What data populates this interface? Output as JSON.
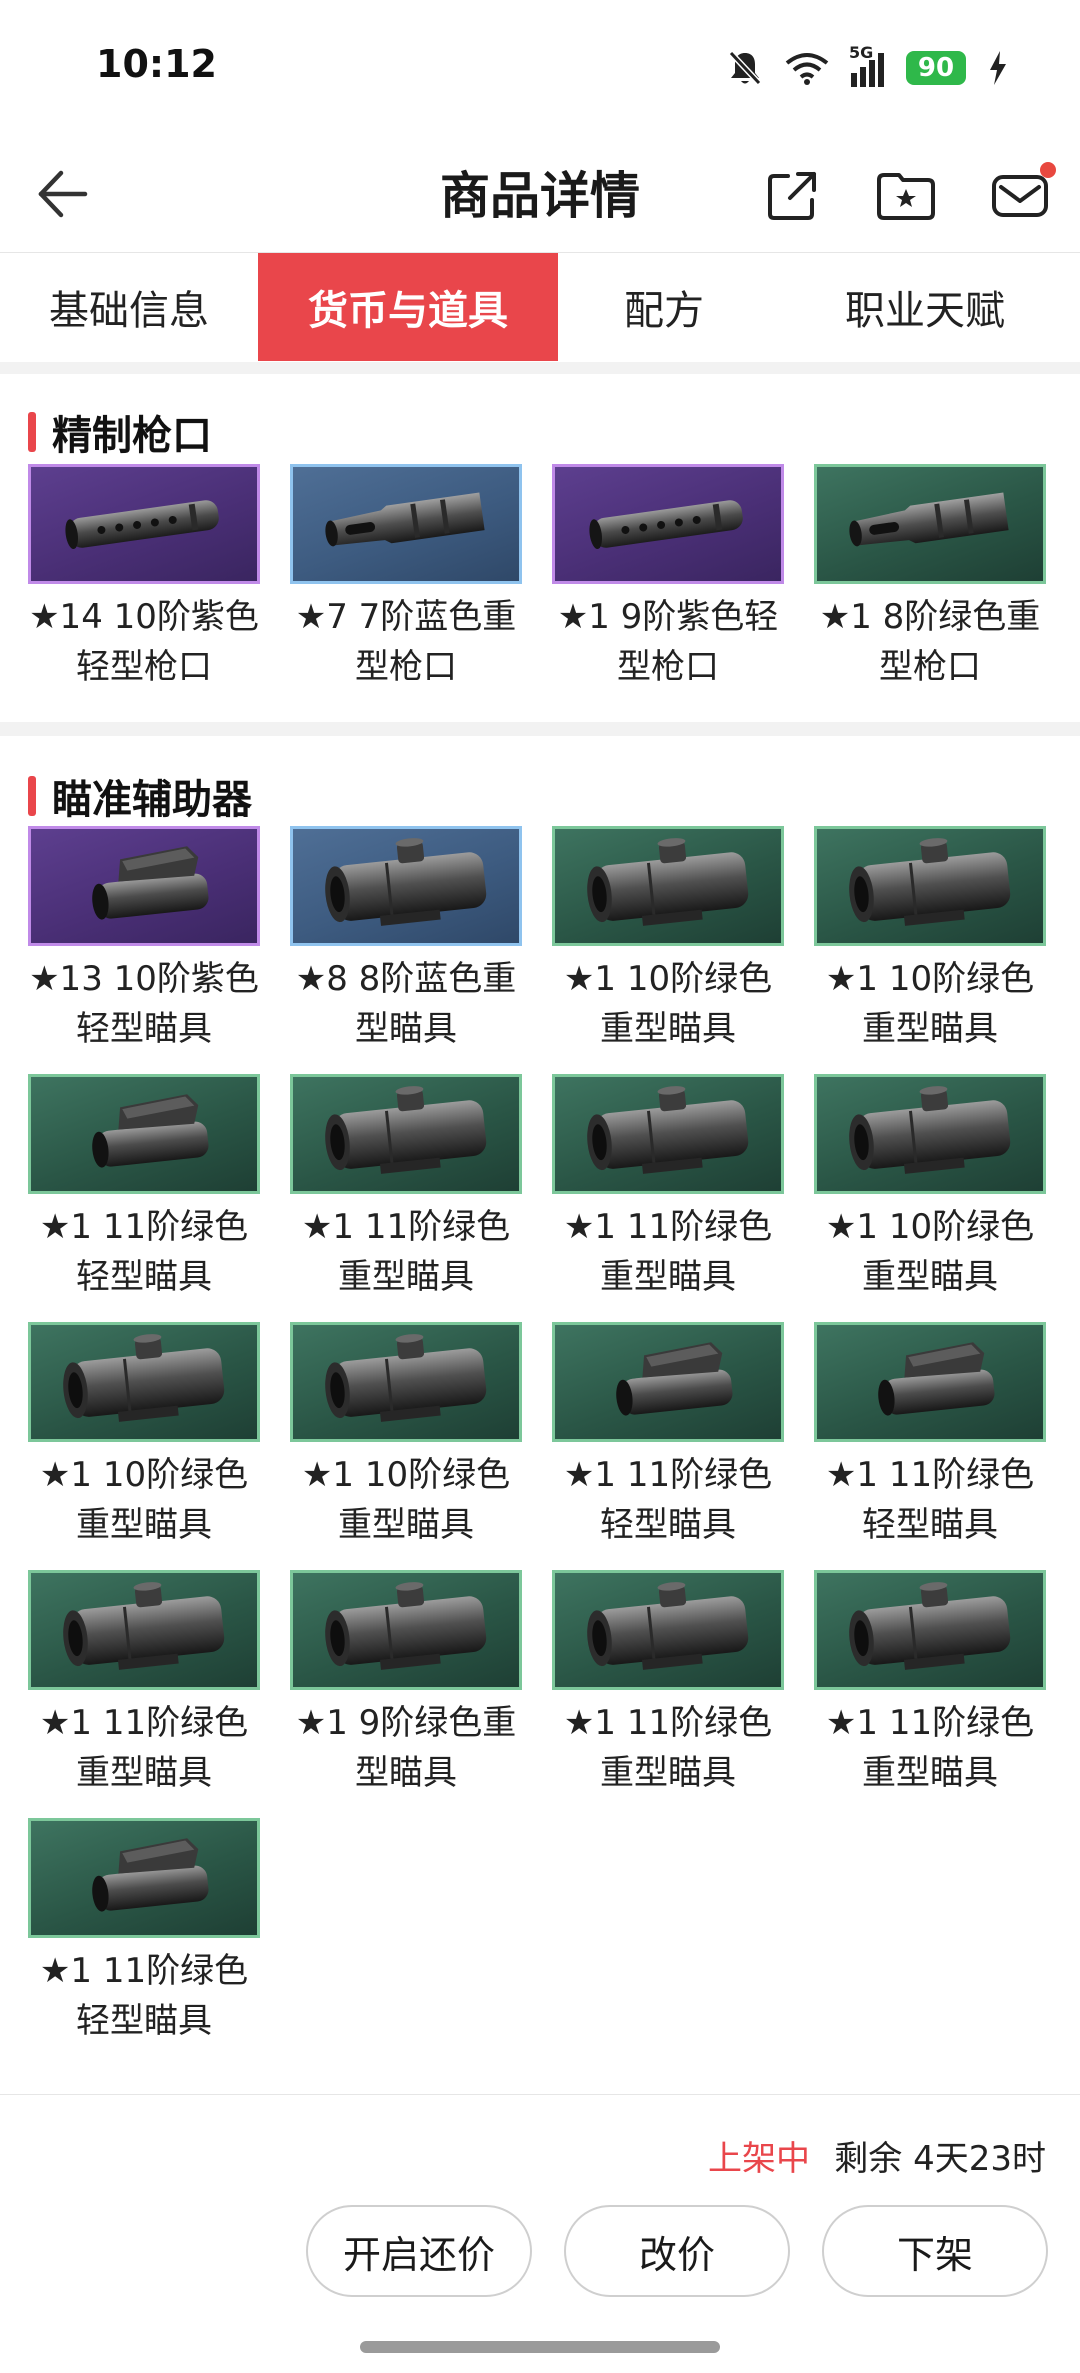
{
  "status_bar": {
    "time": "10:12",
    "network": "5G",
    "battery": "90",
    "icons": [
      "bell-muted-icon",
      "wifi-icon",
      "signal-icon",
      "battery-icon",
      "charging-icon"
    ]
  },
  "header": {
    "title": "商品详情",
    "icons": [
      "back-arrow-icon",
      "share-icon",
      "folder-star-icon",
      "mail-icon"
    ]
  },
  "tabs": [
    {
      "label": "基础信息",
      "active": false
    },
    {
      "label": "货币与道具",
      "active": true
    },
    {
      "label": "配方",
      "active": false
    },
    {
      "label": "职业天赋",
      "active": false
    }
  ],
  "sections": [
    {
      "title": "精制枪口",
      "items": [
        {
          "label": "★14 10阶紫色轻型枪口",
          "rarity": "purple",
          "icon": "muzzle-light-icon"
        },
        {
          "label": "★7 7阶蓝色重型枪口",
          "rarity": "blue",
          "icon": "muzzle-heavy-icon"
        },
        {
          "label": "★1 9阶紫色轻型枪口",
          "rarity": "purple",
          "icon": "muzzle-light-icon"
        },
        {
          "label": "★1 8阶绿色重型枪口",
          "rarity": "green",
          "icon": "muzzle-heavy-icon"
        }
      ]
    },
    {
      "title": "瞄准辅助器",
      "items": [
        {
          "label": "★13 10阶紫色轻型瞄具",
          "rarity": "purple",
          "icon": "scope-light-icon"
        },
        {
          "label": "★8 8阶蓝色重型瞄具",
          "rarity": "blue",
          "icon": "scope-heavy-icon"
        },
        {
          "label": "★1 10阶绿色重型瞄具",
          "rarity": "green",
          "icon": "scope-heavy-icon"
        },
        {
          "label": "★1 10阶绿色重型瞄具",
          "rarity": "green",
          "icon": "scope-heavy-icon"
        },
        {
          "label": "★1 11阶绿色轻型瞄具",
          "rarity": "green",
          "icon": "scope-light-icon"
        },
        {
          "label": "★1 11阶绿色重型瞄具",
          "rarity": "green",
          "icon": "scope-heavy-icon"
        },
        {
          "label": "★1 11阶绿色重型瞄具",
          "rarity": "green",
          "icon": "scope-heavy-icon"
        },
        {
          "label": "★1 10阶绿色重型瞄具",
          "rarity": "green",
          "icon": "scope-heavy-icon"
        },
        {
          "label": "★1 10阶绿色重型瞄具",
          "rarity": "green",
          "icon": "scope-heavy-icon"
        },
        {
          "label": "★1 10阶绿色重型瞄具",
          "rarity": "green",
          "icon": "scope-heavy-icon"
        },
        {
          "label": "★1 11阶绿色轻型瞄具",
          "rarity": "green",
          "icon": "scope-light-icon"
        },
        {
          "label": "★1 11阶绿色轻型瞄具",
          "rarity": "green",
          "icon": "scope-light-icon"
        },
        {
          "label": "★1 11阶绿色重型瞄具",
          "rarity": "green",
          "icon": "scope-heavy-icon"
        },
        {
          "label": "★1 9阶绿色重型瞄具",
          "rarity": "green",
          "icon": "scope-heavy-icon"
        },
        {
          "label": "★1 11阶绿色重型瞄具",
          "rarity": "green",
          "icon": "scope-heavy-icon"
        },
        {
          "label": "★1 11阶绿色重型瞄具",
          "rarity": "green",
          "icon": "scope-heavy-icon"
        },
        {
          "label": "★1 11阶绿色轻型瞄具",
          "rarity": "green",
          "icon": "scope-light-icon"
        }
      ]
    }
  ],
  "footer": {
    "listing_status": "上架中",
    "remaining": "剩余 4天23时",
    "buttons": {
      "counter_offer": "开启还价",
      "change_price": "改价",
      "delist": "下架"
    }
  },
  "colors": {
    "accent": "#e9464b",
    "green": "#2a5646",
    "purple": "#4a2f76",
    "blue": "#3d5b80"
  }
}
